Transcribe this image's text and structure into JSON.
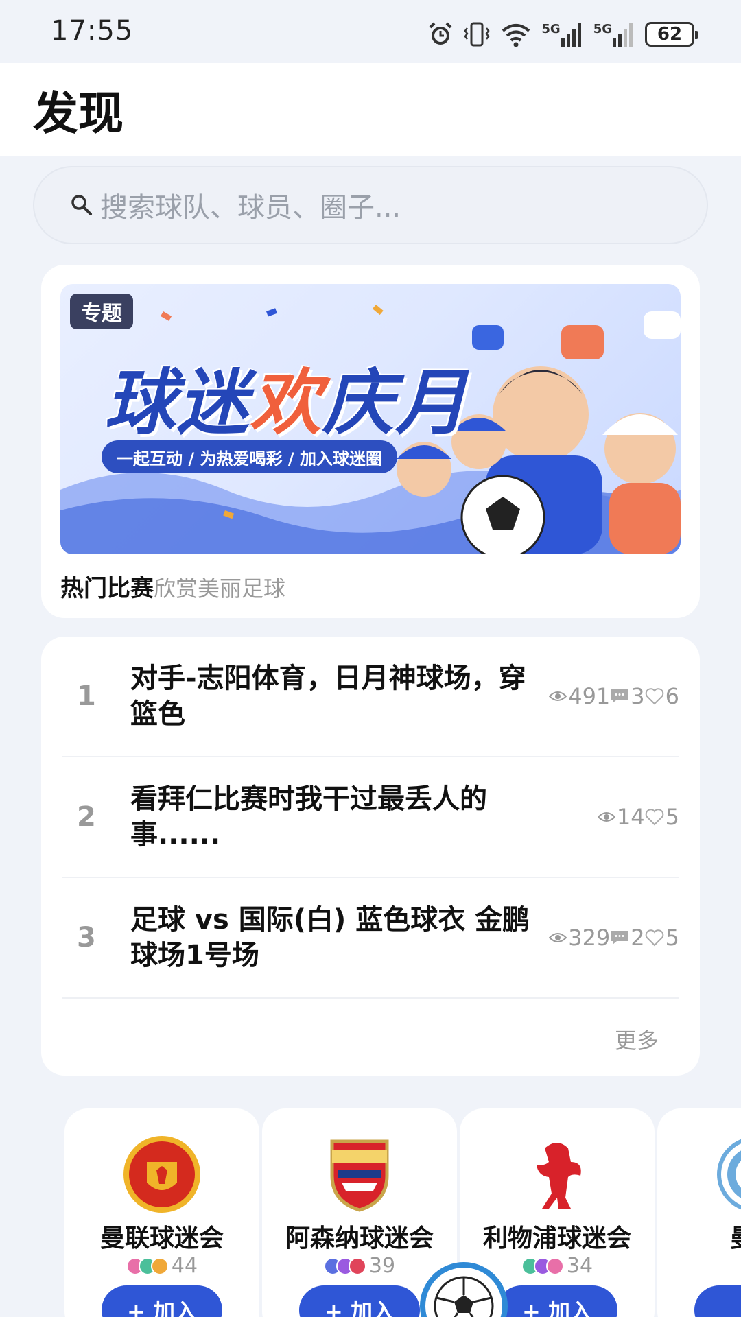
{
  "status_bar": {
    "time": "17:55",
    "battery": "62",
    "network1": "5G",
    "network2": "5G"
  },
  "header": {
    "title": "发现"
  },
  "search": {
    "placeholder": "搜索球队、球员、圈子..."
  },
  "banner": {
    "tag": "专题",
    "title_part1": "球迷",
    "title_highlight": "欢",
    "title_part2": "庆月",
    "pill_text": "一起互动 / 为热爱喝彩 / 加入球迷圈",
    "caption_title": "热门比赛",
    "caption_sub": "欣赏美丽足球"
  },
  "rankings": {
    "items": [
      {
        "rank": "1",
        "title": "对手-志阳体育，日月神球场，穿篮色",
        "views": "491",
        "comments": "3",
        "likes": "6"
      },
      {
        "rank": "2",
        "title": "看拜仁比赛时我干过最丢人的事......",
        "views": "14",
        "comments": "",
        "likes": "5"
      },
      {
        "rank": "3",
        "title": "足球 vs 国际(白) 蓝色球衣 金鹏球场1号场",
        "views": "329",
        "comments": "2",
        "likes": "5"
      }
    ],
    "more_label": "更多"
  },
  "clubs": [
    {
      "name": "曼联球迷会",
      "count": "44",
      "join_label": "+ 加入",
      "dots": [
        "#e86fa8",
        "#4bbf9a",
        "#f0a838"
      ]
    },
    {
      "name": "阿森纳球迷会",
      "count": "39",
      "join_label": "+ 加入",
      "dots": [
        "#5a6fe0",
        "#9a5ae0",
        "#e0445a"
      ]
    },
    {
      "name": "利物浦球迷会",
      "count": "34",
      "join_label": "+ 加入",
      "dots": [
        "#4bbf9a",
        "#9a5ae0",
        "#e86fa8"
      ]
    },
    {
      "name": "曼城",
      "count": "",
      "join_label": "+",
      "dots": [
        "#4bb0e8"
      ]
    }
  ],
  "colors": {
    "accent": "#2f56d6",
    "background": "#f0f3f9"
  }
}
